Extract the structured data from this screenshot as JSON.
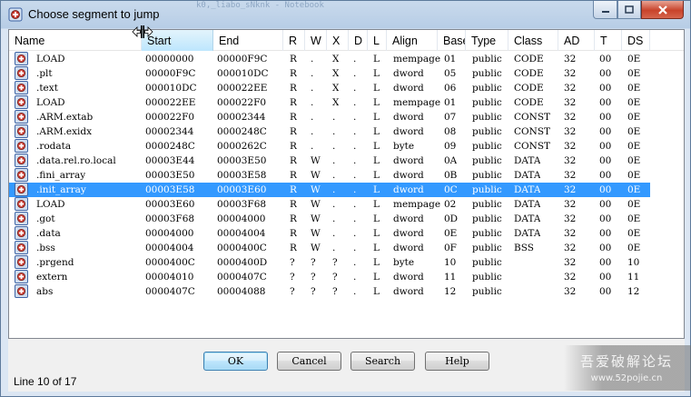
{
  "window": {
    "title": "Choose segment to jump",
    "background_text": "k0,_liabo_sNknk - Notebook"
  },
  "columns": [
    "Name",
    "Start",
    "End",
    "R",
    "W",
    "X",
    "D",
    "L",
    "Align",
    "Base",
    "Type",
    "Class",
    "AD",
    "T",
    "DS"
  ],
  "active_column": "Start",
  "rows": [
    {
      "name": "LOAD",
      "start": "00000000",
      "end": "00000F9C",
      "r": "R",
      "w": ".",
      "x": "X",
      "d": ".",
      "l": "L",
      "align": "mempage",
      "base": "01",
      "type": "public",
      "class": "CODE",
      "ad": "32",
      "t": "00",
      "ds": "0E"
    },
    {
      "name": ".plt",
      "start": "00000F9C",
      "end": "000010DC",
      "r": "R",
      "w": ".",
      "x": "X",
      "d": ".",
      "l": "L",
      "align": "dword",
      "base": "05",
      "type": "public",
      "class": "CODE",
      "ad": "32",
      "t": "00",
      "ds": "0E"
    },
    {
      "name": ".text",
      "start": "000010DC",
      "end": "000022EE",
      "r": "R",
      "w": ".",
      "x": "X",
      "d": ".",
      "l": "L",
      "align": "dword",
      "base": "06",
      "type": "public",
      "class": "CODE",
      "ad": "32",
      "t": "00",
      "ds": "0E"
    },
    {
      "name": "LOAD",
      "start": "000022EE",
      "end": "000022F0",
      "r": "R",
      "w": ".",
      "x": "X",
      "d": ".",
      "l": "L",
      "align": "mempage",
      "base": "01",
      "type": "public",
      "class": "CODE",
      "ad": "32",
      "t": "00",
      "ds": "0E"
    },
    {
      "name": ".ARM.extab",
      "start": "000022F0",
      "end": "00002344",
      "r": "R",
      "w": ".",
      "x": ".",
      "d": ".",
      "l": "L",
      "align": "dword",
      "base": "07",
      "type": "public",
      "class": "CONST",
      "ad": "32",
      "t": "00",
      "ds": "0E"
    },
    {
      "name": ".ARM.exidx",
      "start": "00002344",
      "end": "0000248C",
      "r": "R",
      "w": ".",
      "x": ".",
      "d": ".",
      "l": "L",
      "align": "dword",
      "base": "08",
      "type": "public",
      "class": "CONST",
      "ad": "32",
      "t": "00",
      "ds": "0E"
    },
    {
      "name": ".rodata",
      "start": "0000248C",
      "end": "0000262C",
      "r": "R",
      "w": ".",
      "x": ".",
      "d": ".",
      "l": "L",
      "align": "byte",
      "base": "09",
      "type": "public",
      "class": "CONST",
      "ad": "32",
      "t": "00",
      "ds": "0E"
    },
    {
      "name": ".data.rel.ro.local",
      "start": "00003E44",
      "end": "00003E50",
      "r": "R",
      "w": "W",
      "x": ".",
      "d": ".",
      "l": "L",
      "align": "dword",
      "base": "0A",
      "type": "public",
      "class": "DATA",
      "ad": "32",
      "t": "00",
      "ds": "0E"
    },
    {
      "name": ".fini_array",
      "start": "00003E50",
      "end": "00003E58",
      "r": "R",
      "w": "W",
      "x": ".",
      "d": ".",
      "l": "L",
      "align": "dword",
      "base": "0B",
      "type": "public",
      "class": "DATA",
      "ad": "32",
      "t": "00",
      "ds": "0E"
    },
    {
      "name": ".init_array",
      "start": "00003E58",
      "end": "00003E60",
      "r": "R",
      "w": "W",
      "x": ".",
      "d": ".",
      "l": "L",
      "align": "dword",
      "base": "0C",
      "type": "public",
      "class": "DATA",
      "ad": "32",
      "t": "00",
      "ds": "0E"
    },
    {
      "name": "LOAD",
      "start": "00003E60",
      "end": "00003F68",
      "r": "R",
      "w": "W",
      "x": ".",
      "d": ".",
      "l": "L",
      "align": "mempage",
      "base": "02",
      "type": "public",
      "class": "DATA",
      "ad": "32",
      "t": "00",
      "ds": "0E"
    },
    {
      "name": ".got",
      "start": "00003F68",
      "end": "00004000",
      "r": "R",
      "w": "W",
      "x": ".",
      "d": ".",
      "l": "L",
      "align": "dword",
      "base": "0D",
      "type": "public",
      "class": "DATA",
      "ad": "32",
      "t": "00",
      "ds": "0E"
    },
    {
      "name": ".data",
      "start": "00004000",
      "end": "00004004",
      "r": "R",
      "w": "W",
      "x": ".",
      "d": ".",
      "l": "L",
      "align": "dword",
      "base": "0E",
      "type": "public",
      "class": "DATA",
      "ad": "32",
      "t": "00",
      "ds": "0E"
    },
    {
      "name": ".bss",
      "start": "00004004",
      "end": "0000400C",
      "r": "R",
      "w": "W",
      "x": ".",
      "d": ".",
      "l": "L",
      "align": "dword",
      "base": "0F",
      "type": "public",
      "class": "BSS",
      "ad": "32",
      "t": "00",
      "ds": "0E"
    },
    {
      "name": ".prgend",
      "start": "0000400C",
      "end": "0000400D",
      "r": "?",
      "w": "?",
      "x": "?",
      "d": ".",
      "l": "L",
      "align": "byte",
      "base": "10",
      "type": "public",
      "class": "",
      "ad": "32",
      "t": "00",
      "ds": "10"
    },
    {
      "name": "extern",
      "start": "00004010",
      "end": "0000407C",
      "r": "?",
      "w": "?",
      "x": "?",
      "d": ".",
      "l": "L",
      "align": "dword",
      "base": "11",
      "type": "public",
      "class": "",
      "ad": "32",
      "t": "00",
      "ds": "11"
    },
    {
      "name": "abs",
      "start": "0000407C",
      "end": "00004088",
      "r": "?",
      "w": "?",
      "x": "?",
      "d": ".",
      "l": "L",
      "align": "dword",
      "base": "12",
      "type": "public",
      "class": "",
      "ad": "32",
      "t": "00",
      "ds": "12"
    }
  ],
  "selected_row": 9,
  "buttons": {
    "ok": "OK",
    "cancel": "Cancel",
    "search": "Search",
    "help": "Help"
  },
  "status": "Line 10 of 17",
  "watermark": {
    "line1": "吾爱破解论坛",
    "line2": "www.52pojie.cn"
  },
  "icons": {
    "app": "ida-segment-icon",
    "segment": "segment-icon",
    "cursor": "column-resize-cursor-icon"
  },
  "colors": {
    "selection": "#3399ff",
    "titlebar": "#c9daec",
    "close": "#c8432b"
  }
}
